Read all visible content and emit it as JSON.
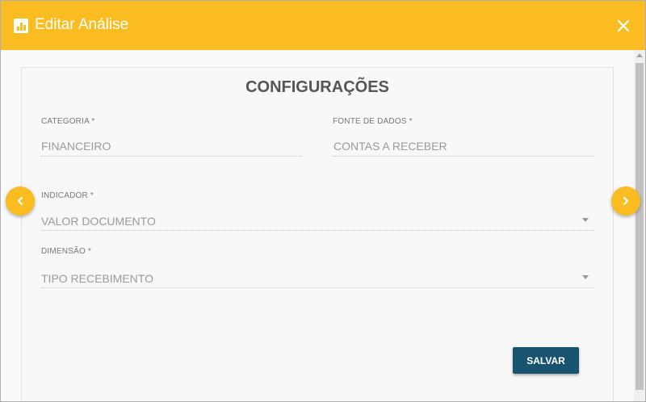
{
  "header": {
    "title": "Editar Análise",
    "title_icon": "bar-chart-icon",
    "close_icon": "close-icon"
  },
  "panel": {
    "title": "CONFIGURAÇÕES"
  },
  "fields": {
    "categoria": {
      "label": "CATEGORIA *",
      "value": "FINANCEIRO"
    },
    "fonte_dados": {
      "label": "FONTE DE DADOS *",
      "value": "CONTAS A RECEBER"
    },
    "indicador": {
      "label": "INDICADOR *",
      "value": "VALOR DOCUMENTO"
    },
    "dimensao": {
      "label": "DIMENSÃO *",
      "value": "TIPO RECEBIMENTO"
    }
  },
  "actions": {
    "save_label": "SALVAR"
  },
  "navigation": {
    "prev_icon": "chevron-left-icon",
    "next_icon": "chevron-right-icon"
  },
  "colors": {
    "accent": "#fbbc22",
    "primary_button": "#18546f"
  }
}
